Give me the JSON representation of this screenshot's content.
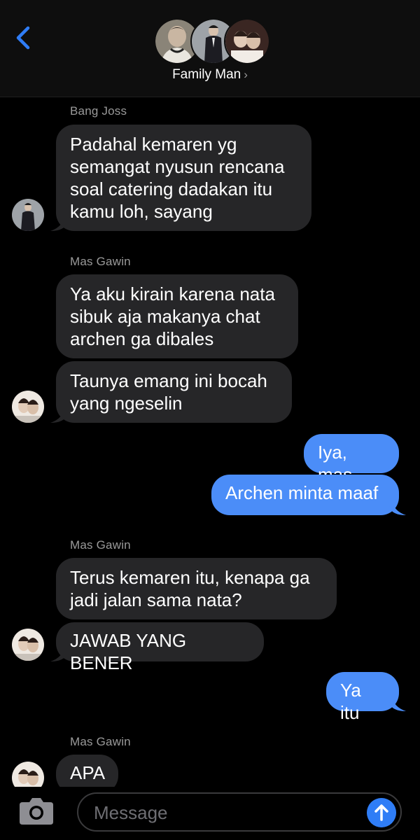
{
  "header": {
    "title": "Family Man",
    "chevron": "›",
    "back_icon": "chevron-left-icon",
    "accent": "#2f7df6"
  },
  "messages": [
    {
      "sender": "Bang Joss",
      "text": "Padahal kemaren yg\nsemangat nyusun rencana\nsoal catering dadakan itu\nkamu loh, sayang"
    },
    {
      "sender": "Mas Gawin",
      "text": "Ya aku kirain karena nata\nsibuk aja makanya chat\narchen ga dibales"
    },
    {
      "text": "Taunya emang ini bocah\nyang ngeselin"
    },
    {
      "text": "Iya, mas"
    },
    {
      "text": "Archen minta maaf"
    },
    {
      "sender": "Mas Gawin",
      "text": "Terus kemaren itu, kenapa ga\njadi jalan sama nata?"
    },
    {
      "text": "JAWAB YANG BENER"
    },
    {
      "text": "Ya itu"
    },
    {
      "sender": "Mas Gawin",
      "text": "APA"
    }
  ],
  "composer": {
    "placeholder": "Message",
    "camera_icon": "camera-icon",
    "send_icon": "arrow-up-icon"
  },
  "colors": {
    "incoming_bubble": "#262628",
    "outgoing_bubble": "#4b8df8",
    "background": "#000000"
  }
}
